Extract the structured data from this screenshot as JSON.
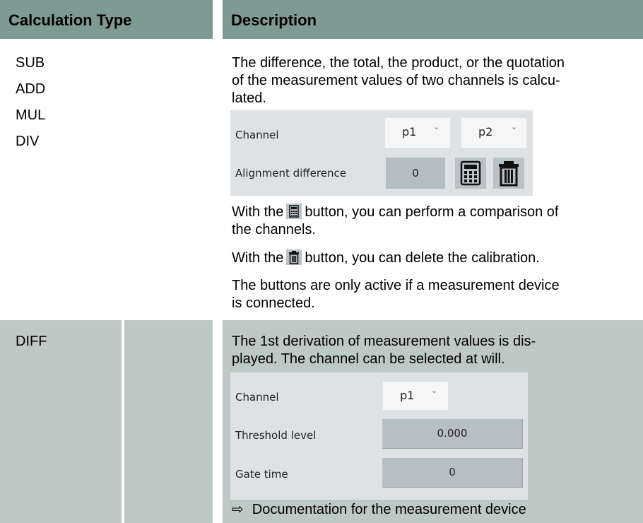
{
  "headers": {
    "calc_type": "Calculation Type",
    "description": "Description"
  },
  "row1": {
    "types": [
      "SUB",
      "ADD",
      "MUL",
      "DIV"
    ],
    "intro": [
      "The difference, the total, the product, or the quotation",
      "of the measurement values of two channels is calcu-",
      "lated."
    ],
    "panel": {
      "channel_label": "Channel",
      "channel_a": "p1",
      "channel_b": "p2",
      "alignment_label": "Alignment difference",
      "alignment_value": "0"
    },
    "calc_text_before": "With the",
    "calc_text_after": "button, you can perform a comparison of",
    "calc_text_line2": "the channels.",
    "delete_text_before": "With the",
    "delete_text_after": "button, you can delete the calibration.",
    "note": [
      "The buttons are only active if a measurement device",
      "is connected."
    ]
  },
  "row2": {
    "type": "DIFF",
    "intro": [
      "The 1st derivation of measurement values is dis-",
      "played. The channel can be selected at will."
    ],
    "panel": {
      "channel_label": "Channel",
      "channel_value": "p1",
      "threshold_label": "Threshold level",
      "threshold_value": "0.000",
      "gate_label": "Gate time",
      "gate_value": "0"
    },
    "link_arrow": "⇨",
    "link_text": "Documentation for the measurement device"
  },
  "icons": {
    "calculator": "calculator-icon",
    "trash": "trash-icon",
    "chevron": "chevron-down-icon"
  },
  "colors": {
    "header_bg": "#7f9a92",
    "row_grey": "#bdc9c5",
    "panel_bg": "#dfe2e4"
  }
}
